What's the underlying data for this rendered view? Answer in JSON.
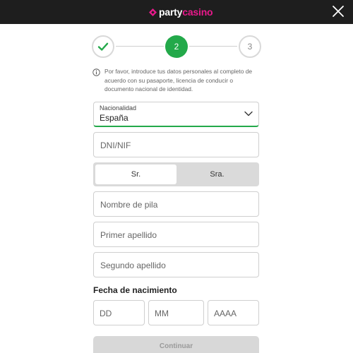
{
  "header": {
    "logo_party": "party",
    "logo_casino": "casino"
  },
  "stepper": {
    "current_step": 2,
    "step2_label": "2",
    "step3_label": "3"
  },
  "info_text": "Por favor, introduce tus datos personales al completo de acuerdo con su pasaporte, licencia de conducir o documento nacional de identidad.",
  "nationality": {
    "caption": "Nacionalidad",
    "value": "España"
  },
  "fields": {
    "dni": "DNI/NIF",
    "first_name": "Nombre de pila",
    "last_name1": "Primer apellido",
    "last_name2": "Segundo apellido"
  },
  "gender": {
    "options": [
      "Sr.",
      "Sra."
    ],
    "selected": "Sr."
  },
  "birthdate": {
    "title": "Fecha de nacimiento",
    "day": "DD",
    "month": "MM",
    "year": "AAAA"
  },
  "continue_label": "Continuar",
  "colors": {
    "brand_pink": "#e8198b",
    "success_green": "#23a94a",
    "header_bg": "#1e1e1e"
  }
}
